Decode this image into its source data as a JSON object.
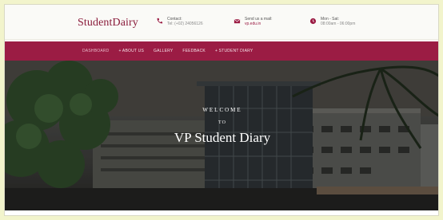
{
  "header": {
    "brand": "StudentDairy",
    "contact": {
      "label": "Contact:",
      "value": "Tel: (+02) 24056126"
    },
    "mail": {
      "label": "Send us a mail:",
      "value": "vp.edu.in"
    },
    "hours": {
      "label": "Mon - Sat:",
      "value": "08:00am - 06:00pm"
    }
  },
  "nav": {
    "items": [
      {
        "label": "Dashboard"
      },
      {
        "label": "+ About Us"
      },
      {
        "label": "Gallery"
      },
      {
        "label": "Feedback"
      },
      {
        "label": "+ Student Diary"
      }
    ]
  },
  "hero": {
    "welcome": "WELCOME",
    "to": "TO",
    "title": "VP Student Diary"
  },
  "colors": {
    "brand": "#8a1c3b",
    "nav_bg": "#9b1c44",
    "page_bg": "#f2f4cc"
  }
}
